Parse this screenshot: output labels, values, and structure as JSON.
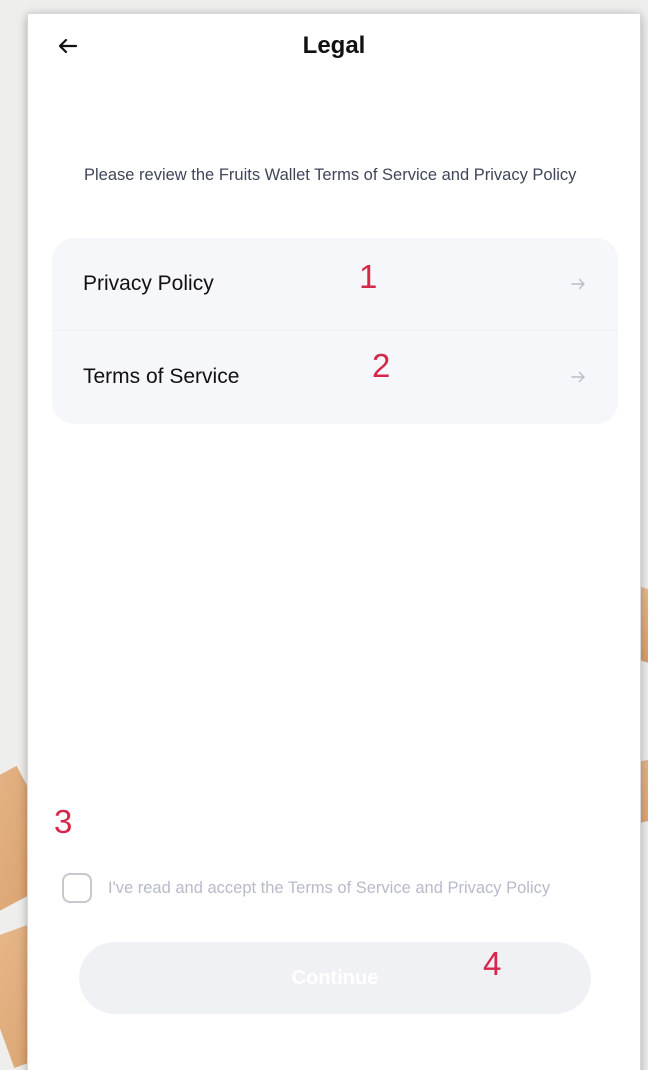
{
  "header": {
    "title": "Legal",
    "back_icon": "arrow-left-icon"
  },
  "intro": {
    "text": "Please review the Fruits Wallet Terms of Service and Privacy Policy"
  },
  "legal_items": [
    {
      "label": "Privacy Policy",
      "icon": "arrow-right-icon"
    },
    {
      "label": "Terms of Service",
      "icon": "arrow-right-icon"
    }
  ],
  "accept": {
    "label": "I've read and accept the Terms of Service and Privacy Policy",
    "checked": false
  },
  "continue_button": {
    "label": "Continue",
    "enabled": false
  },
  "annotations": [
    "1",
    "2",
    "3",
    "4"
  ],
  "colors": {
    "annotation": "#d6274a",
    "card_bg": "#f6f7fb",
    "button_disabled_bg": "#f0f1f5",
    "muted_text": "#b7bbc9"
  }
}
